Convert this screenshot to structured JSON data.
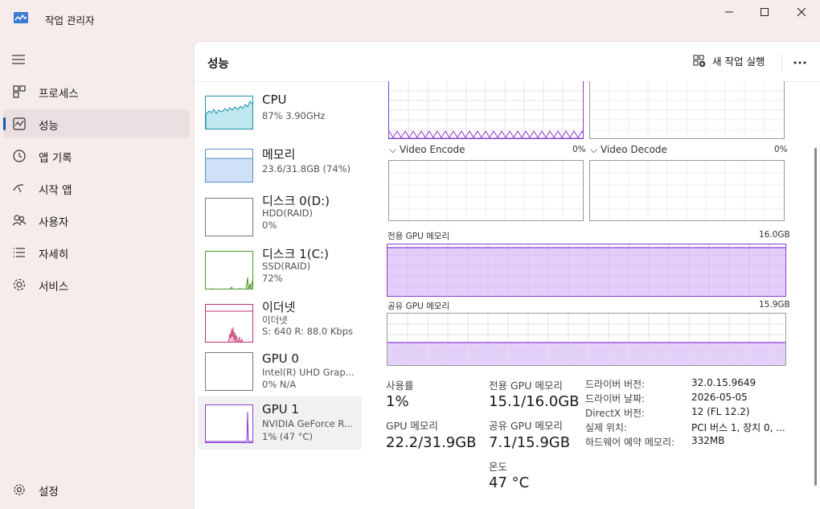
{
  "window": {
    "title": "작업 관리자"
  },
  "nav": {
    "items": [
      {
        "label": "프로세스",
        "icon": "processes-icon"
      },
      {
        "label": "성능",
        "icon": "performance-icon"
      },
      {
        "label": "앱 기록",
        "icon": "history-icon"
      },
      {
        "label": "시작 앱",
        "icon": "startup-icon"
      },
      {
        "label": "사용자",
        "icon": "users-icon"
      },
      {
        "label": "자세히",
        "icon": "details-icon"
      },
      {
        "label": "서비스",
        "icon": "services-icon"
      }
    ],
    "settings_label": "설정",
    "active_index": 1
  },
  "header": {
    "title": "성능",
    "new_task_label": "새 작업 실행",
    "more_label": "···"
  },
  "resources": [
    {
      "title": "CPU",
      "lines": [
        "87% 3.90GHz"
      ]
    },
    {
      "title": "메모리",
      "lines": [
        "23.6/31.8GB (74%)"
      ]
    },
    {
      "title": "디스크 0(D:)",
      "lines": [
        "HDD(RAID)",
        "0%"
      ]
    },
    {
      "title": "디스크 1(C:)",
      "lines": [
        "SSD(RAID)",
        "72%"
      ]
    },
    {
      "title": "이더넷",
      "lines": [
        "이더넷",
        "S: 640  R: 88.0 Kbps"
      ]
    },
    {
      "title": "GPU 0",
      "lines": [
        "Intel(R) UHD Grap...",
        "0% N/A"
      ]
    },
    {
      "title": "GPU 1",
      "lines": [
        "NVIDIA GeForce R...",
        "1% (47 °C)"
      ]
    }
  ],
  "engines": {
    "video_encode": {
      "label": "Video Encode",
      "percent": "0%"
    },
    "video_decode": {
      "label": "Video Decode",
      "percent": "0%"
    }
  },
  "memory_graphs": {
    "dedicated": {
      "label": "전용 GPU 메모리",
      "max": "16.0GB",
      "fraction": 0.94
    },
    "shared": {
      "label": "공유 GPU 메모리",
      "max": "15.9GB",
      "fraction": 0.45
    }
  },
  "stats": {
    "utilization": {
      "label": "사용률",
      "value": "1%"
    },
    "dedicated_mem": {
      "label": "전용 GPU 메모리",
      "value": "15.1/16.0GB"
    },
    "gpu_mem": {
      "label": "GPU 메모리",
      "value": "22.2/31.9GB"
    },
    "shared_mem": {
      "label": "공유 GPU 메모리",
      "value": "7.1/15.9GB"
    },
    "temperature": {
      "label": "온도",
      "value": "47 °C"
    }
  },
  "info": [
    {
      "label": "드라이버 버전:",
      "value": "32.0.15.9649"
    },
    {
      "label": "드라이버 날짜:",
      "value": "2026-05-05"
    },
    {
      "label": "DirectX 버전:",
      "value": "12 (FL 12.2)"
    },
    {
      "label": "실제 위치:",
      "value": "PCI 버스 1, 장치 0, ..."
    },
    {
      "label": "하드웨어 예약 메모리:",
      "value": "332MB"
    }
  ],
  "colors": {
    "accent": "#0d5fa8",
    "gpu_line": "#8b3fd0",
    "gpu_fill": "#e4cffa",
    "cpu_line": "#1e8fa8",
    "cpu_fill": "#bfe7ef",
    "mem_line": "#5a8ac8",
    "mem_fill": "#cfe1f7",
    "disk_line": "#4a9a2a",
    "eth_line": "#c0306a"
  }
}
